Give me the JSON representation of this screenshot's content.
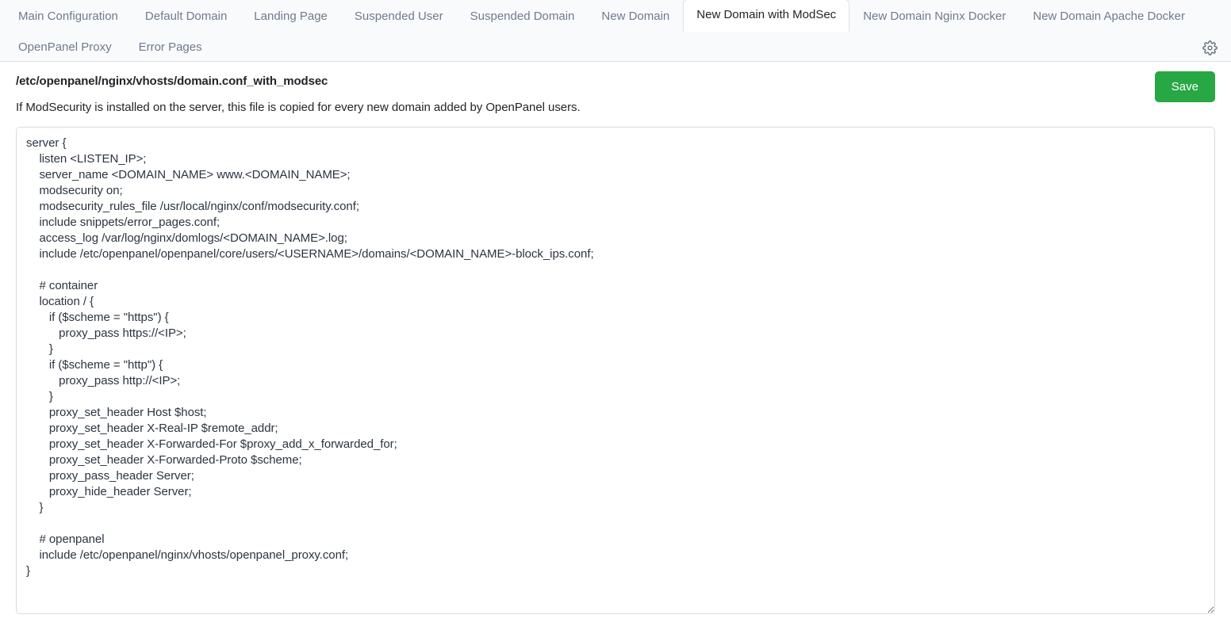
{
  "tabs": {
    "row1": [
      {
        "label": "Main Configuration",
        "active": false
      },
      {
        "label": "Default Domain",
        "active": false
      },
      {
        "label": "Landing Page",
        "active": false
      },
      {
        "label": "Suspended User",
        "active": false
      },
      {
        "label": "Suspended Domain",
        "active": false
      },
      {
        "label": "New Domain",
        "active": false
      },
      {
        "label": "New Domain with ModSec",
        "active": true
      },
      {
        "label": "New Domain Nginx Docker",
        "active": false
      },
      {
        "label": "New Domain Apache Docker",
        "active": false
      }
    ],
    "row2": [
      {
        "label": "OpenPanel Proxy",
        "active": false
      },
      {
        "label": "Error Pages",
        "active": false
      }
    ],
    "settings_icon": "gear-icon"
  },
  "header": {
    "file_path": "/etc/openpanel/nginx/vhosts/domain.conf_with_modsec",
    "description": "If ModSecurity is installed on the server, this file is copied for every new domain added by OpenPanel users.",
    "save_label": "Save"
  },
  "editor": {
    "content": "server {\n    listen <LISTEN_IP>;\n    server_name <DOMAIN_NAME> www.<DOMAIN_NAME>;\n    modsecurity on;\n    modsecurity_rules_file /usr/local/nginx/conf/modsecurity.conf;\n    include snippets/error_pages.conf;\n    access_log /var/log/nginx/domlogs/<DOMAIN_NAME>.log;\n    include /etc/openpanel/openpanel/core/users/<USERNAME>/domains/<DOMAIN_NAME>-block_ips.conf;\n\n    # container\n    location / {\n       if ($scheme = \"https\") {\n          proxy_pass https://<IP>;\n       }\n       if ($scheme = \"http\") {\n          proxy_pass http://<IP>;\n       }\n       proxy_set_header Host $host;\n       proxy_set_header X-Real-IP $remote_addr;\n       proxy_set_header X-Forwarded-For $proxy_add_x_forwarded_for;\n       proxy_set_header X-Forwarded-Proto $scheme;\n       proxy_pass_header Server;\n       proxy_hide_header Server;\n    }\n\n    # openpanel\n    include /etc/openpanel/nginx/vhosts/openpanel_proxy.conf;\n}",
    "placeholder": ""
  },
  "colors": {
    "accent_save": "#28a745",
    "tabbar_bg": "#f9fafc",
    "border": "#dee2e6",
    "text_muted": "#6f7b8c",
    "text_dark": "#212529"
  }
}
